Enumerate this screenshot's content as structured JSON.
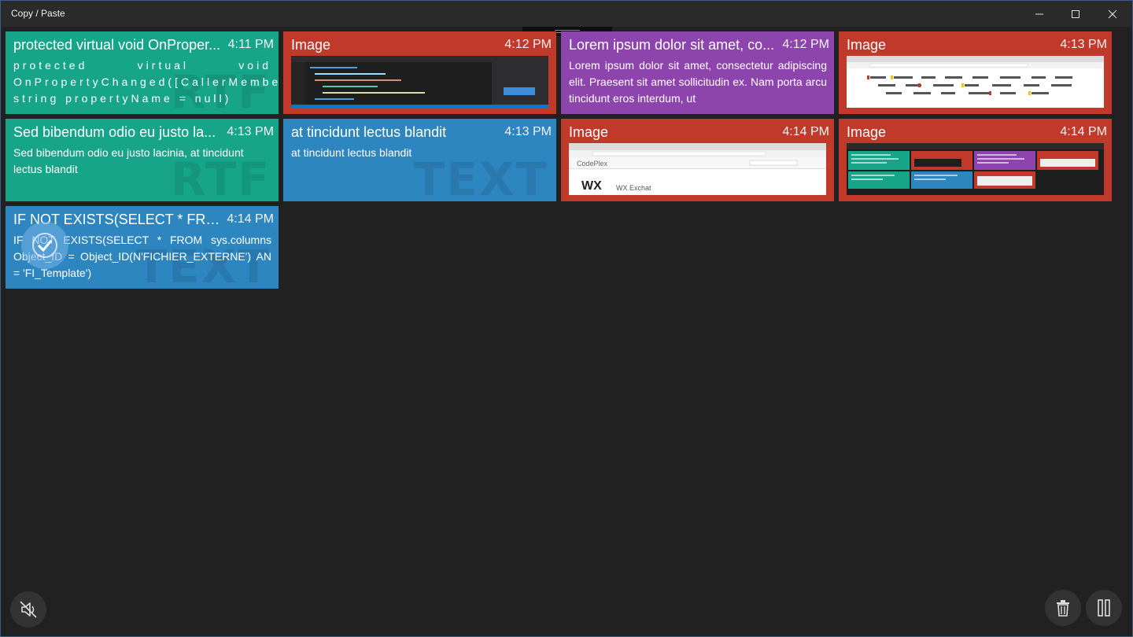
{
  "window": {
    "title": "Copy / Paste"
  },
  "cards": [
    {
      "title": "protected virtual void OnProper...",
      "time": "4:11 PM",
      "body": "protected virtual void OnPropertyChanged([CallerMemberName] string propertyName = null)",
      "watermark": "RTF",
      "color": "#17a589"
    },
    {
      "title": "Image",
      "time": "4:12 PM",
      "color": "#c0392b"
    },
    {
      "title": "Lorem ipsum dolor sit amet, co...",
      "time": "4:12 PM",
      "body": "Lorem ipsum dolor sit amet, consectetur adipiscing elit. Praesent sit amet sollicitudin ex. Nam porta arcu tincidunt eros interdum, ut",
      "color": "#8e44ad"
    },
    {
      "title": "Image",
      "time": "4:13 PM",
      "color": "#c0392b"
    },
    {
      "title": "Sed bibendum odio eu justo la...",
      "time": "4:13 PM",
      "body": "Sed bibendum odio eu justo lacinia, at tincidunt lectus blandit",
      "watermark": "RTF",
      "color": "#17a589"
    },
    {
      "title": "at tincidunt lectus blandit",
      "time": "4:13 PM",
      "body": "at tincidunt lectus blandit",
      "watermark": "TEXT",
      "color": "#2e86c1"
    },
    {
      "title": "Image",
      "time": "4:14 PM",
      "color": "#c0392b",
      "thumb_text": "CodePlex",
      "thumb_logo": "WX",
      "thumb_caption": "WX Exchat"
    },
    {
      "title": "Image",
      "time": "4:14 PM",
      "color": "#c0392b"
    },
    {
      "title": "IF NOT EXISTS(SELECT * FROM...",
      "time": "4:14 PM",
      "body": "IF NOT EXISTS(SELECT * FROM sys.columns Object_ID = Object_ID(N'FICHIER_EXTERNE') AN = 'FI_Template')",
      "watermark": "TEXT",
      "color": "#2e86c1"
    }
  ],
  "controls": {
    "mute_icon": "speaker-off-icon",
    "delete_icon": "trash-icon",
    "pause_icon": "pause-icon"
  }
}
